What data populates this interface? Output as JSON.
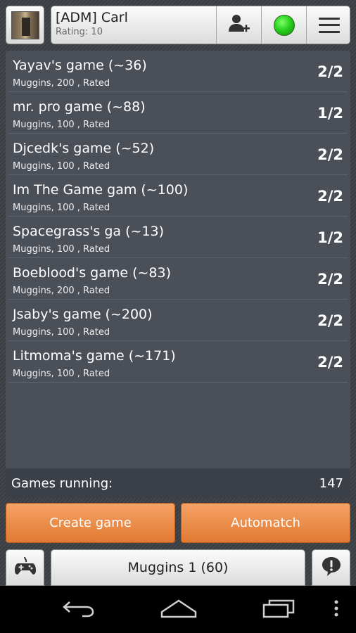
{
  "header": {
    "user_name": "[ADM] Carl",
    "rating": "Rating: 10",
    "status_color": "#2bd11d",
    "icons": [
      "add-friend-icon",
      "online-status-icon",
      "menu-icon"
    ]
  },
  "games": [
    {
      "title": "Yayav's game (~36)",
      "subtitle": "Muggins, 200 , Rated",
      "slots": "2/2"
    },
    {
      "title": "mr. pro game (~88)",
      "subtitle": "Muggins, 100 , Rated",
      "slots": "1/2"
    },
    {
      "title": "Djcedk's game (~52)",
      "subtitle": "Muggins, 100 , Rated",
      "slots": "2/2"
    },
    {
      "title": "Im The Game gam (~100)",
      "subtitle": "Muggins, 100 , Rated",
      "slots": "2/2"
    },
    {
      "title": "Spacegrass's ga (~13)",
      "subtitle": "Muggins, 100 , Rated",
      "slots": "1/2"
    },
    {
      "title": "Boeblood's game (~83)",
      "subtitle": "Muggins, 200 , Rated",
      "slots": "2/2"
    },
    {
      "title": "Jsaby's game (~200)",
      "subtitle": "Muggins, 100 , Rated",
      "slots": "2/2"
    },
    {
      "title": "Litmoma's game (~171)",
      "subtitle": "Muggins, 100 , Rated",
      "slots": "2/2"
    }
  ],
  "status": {
    "running_label": "Games running:",
    "running_count": "147"
  },
  "actions": {
    "create_label": "Create game",
    "automatch_label": "Automatch",
    "accent_color": "#e98a44"
  },
  "bottom": {
    "mode_label": "Muggins 1 (60)",
    "icons": [
      "gamepad-icon",
      "chat-alert-icon"
    ]
  },
  "navbar": {
    "icons": [
      "back-icon",
      "home-icon",
      "recent-apps-icon",
      "overflow-icon"
    ]
  }
}
